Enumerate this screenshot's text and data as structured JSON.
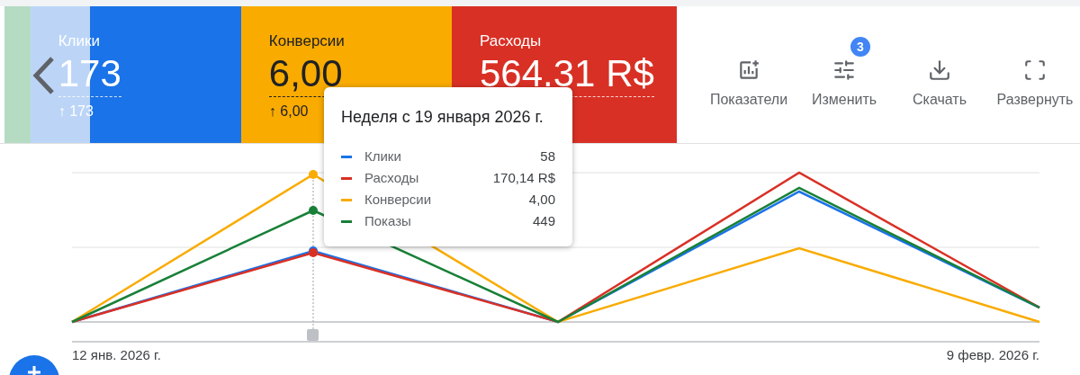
{
  "metric_cards": [
    {
      "label": "Клики",
      "value": "173",
      "delta": "↑ 173",
      "color": "#1a73e8",
      "faded": true
    },
    {
      "label": "Конверсии",
      "value": "6,00",
      "delta": "↑ 6,00",
      "color": "#f9ab00",
      "faded": false
    },
    {
      "label": "Расходы",
      "value": "564.31 R$",
      "color": "#d93025",
      "faded": false
    }
  ],
  "toolbar": [
    {
      "kind": "metrics",
      "label": "Показатели"
    },
    {
      "kind": "adjust",
      "label": "Изменить",
      "badge": "3"
    },
    {
      "kind": "download",
      "label": "Скачать"
    },
    {
      "kind": "expand",
      "label": "Развернуть"
    }
  ],
  "chart": {
    "x_start_label": "12 янв. 2026 г.",
    "x_end_label": "9 февр. 2026 г.",
    "tooltip": {
      "title": "Неделя с 19 января 2026 г.",
      "rows": [
        {
          "name": "Клики",
          "value": "58",
          "color": "#1a73e8"
        },
        {
          "name": "Расходы",
          "value": "170,14 R$",
          "color": "#d93025"
        },
        {
          "name": "Конверсии",
          "value": "4,00",
          "color": "#f9ab00"
        },
        {
          "name": "Показы",
          "value": "449",
          "color": "#188038"
        }
      ]
    }
  }
}
